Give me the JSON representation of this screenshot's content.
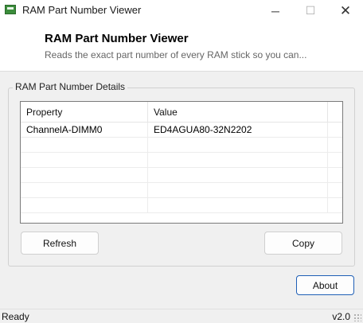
{
  "window": {
    "title": "RAM Part Number Viewer",
    "minimize_glyph": "─",
    "maximize_glyph": "☐",
    "close_glyph": "✕"
  },
  "header": {
    "title": "RAM Part Number Viewer",
    "subtitle": "Reads the exact part number of every RAM stick so you can..."
  },
  "group": {
    "label": "RAM Part Number Details"
  },
  "table": {
    "columns": [
      "Property",
      "Value"
    ],
    "rows": [
      [
        "ChannelA-DIMM0",
        "ED4AGUA80-32N2202"
      ]
    ]
  },
  "buttons": {
    "refresh": "Refresh",
    "copy": "Copy",
    "about": "About"
  },
  "status": {
    "text": "Ready",
    "version": "v2.0"
  },
  "colors": {
    "accent": "#1f5fb6",
    "window_bg": "#f0f0f0",
    "header_bg": "#ffffff"
  }
}
